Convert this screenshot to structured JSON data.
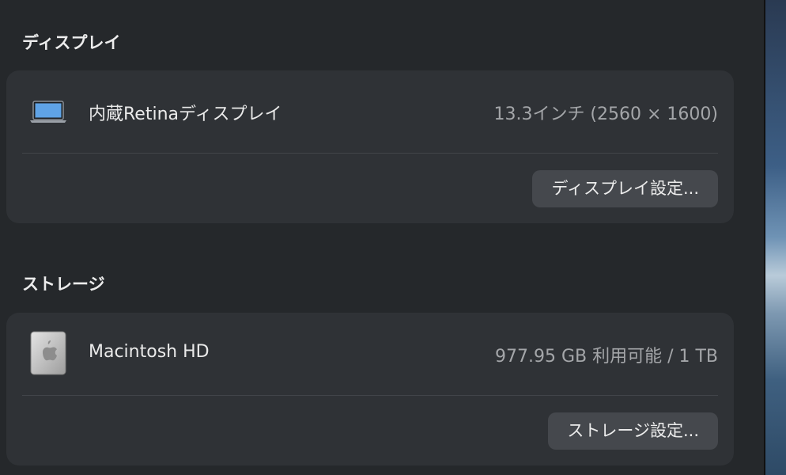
{
  "display_section": {
    "title": "ディスプレイ",
    "item_label": "内蔵Retinaディスプレイ",
    "item_value": "13.3インチ (2560 × 1600)",
    "button_label": "ディスプレイ設定..."
  },
  "storage_section": {
    "title": "ストレージ",
    "item_label": "Macintosh HD",
    "item_value": "977.95 GB 利用可能 / 1 TB",
    "button_label": "ストレージ設定..."
  },
  "icons": {
    "display": "laptop-icon",
    "storage": "hard-drive-icon"
  }
}
